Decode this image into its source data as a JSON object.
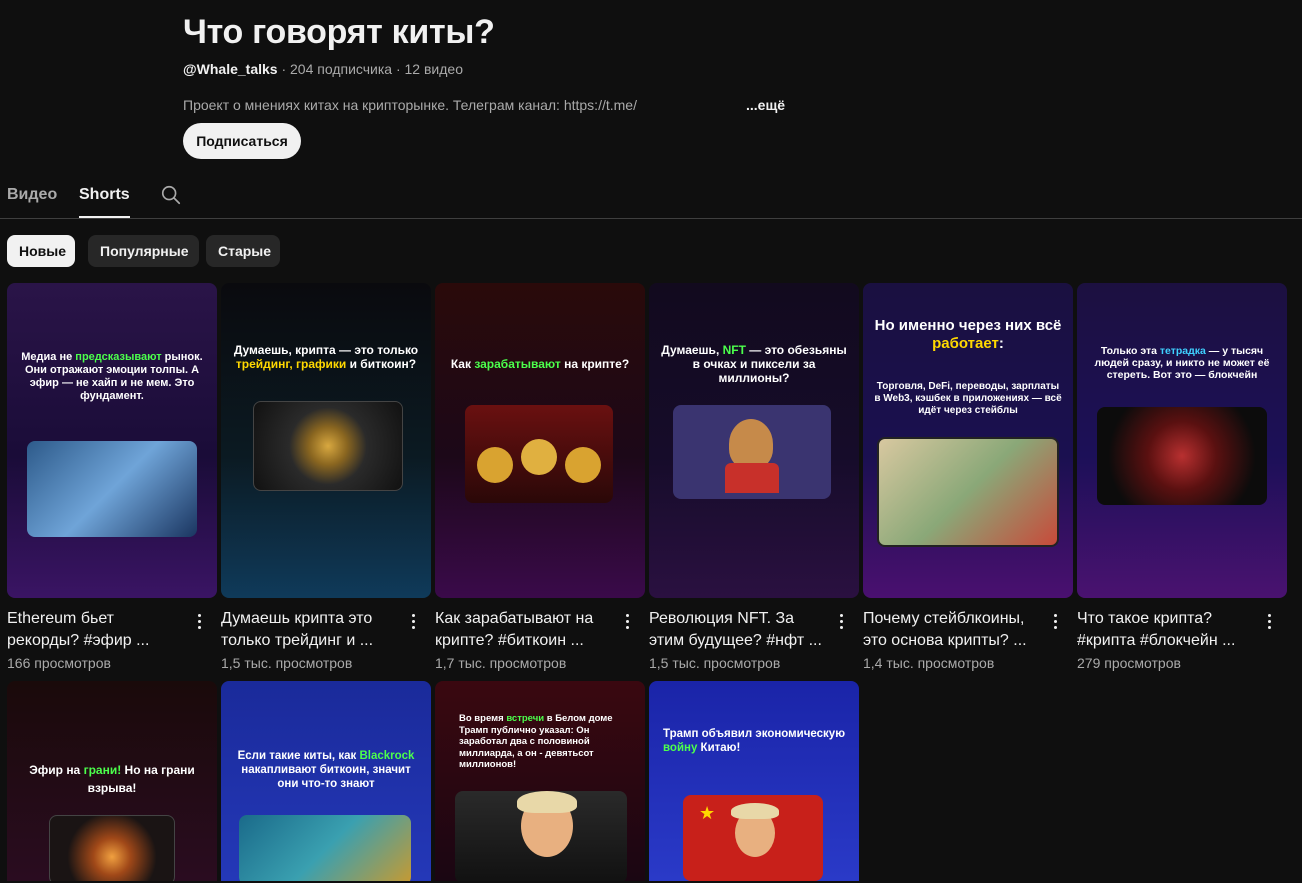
{
  "channel": {
    "title": "Что говорят киты?",
    "handle": "@Whale_talks",
    "subscribers": "· 204 подписчика",
    "videos": "· 12 видео",
    "description": "Проект о мнениях китах на крипторынке. Телеграм канал: https://t.me/",
    "more_label": "...ещё",
    "subscribe_label": "Подписаться"
  },
  "tabs": [
    {
      "label": "Видео",
      "active": false
    },
    {
      "label": "Shorts",
      "active": true
    }
  ],
  "chips": [
    {
      "label": "Новые",
      "selected": true
    },
    {
      "label": "Популярные",
      "selected": false
    },
    {
      "label": "Старые",
      "selected": false
    }
  ],
  "shorts": [
    {
      "title": "Ethereum бьет рекорды? #эфир ...",
      "views": "166 просмотров",
      "thumb": {
        "pre": "Медиа не ",
        "hl": "предсказывают",
        "post": " рынок. Они отражают эмоции толпы. А эфир — не хайп и не мем. Это фундамент."
      }
    },
    {
      "title": "Думаешь крипта это только трейдинг и ...",
      "views": "1,5 тыс. просмотров",
      "thumb": {
        "pre": "Думаешь, крипта — это только ",
        "hl": "трейдинг, графики",
        "post": " и биткоин?"
      }
    },
    {
      "title": "Как зарабатывают на крипте? #биткоин ...",
      "views": "1,7 тыс. просмотров",
      "thumb": {
        "pre": "Как ",
        "hl": "зарабатывают",
        "post": " на крипте?"
      }
    },
    {
      "title": "Революция NFT. За этим будущее? #нфт ...",
      "views": "1,5 тыс. просмотров",
      "thumb": {
        "pre": "Думаешь, ",
        "hl": "NFT",
        "post": " — это обезьяны в очках и пиксели за миллионы?"
      }
    },
    {
      "title": "Почему стейблкоины, это основа крипты? ...",
      "views": "1,4 тыс. просмотров",
      "thumb": {
        "pre": "Но именно через них всё ",
        "hl": "работает",
        "post": ":"
      }
    },
    {
      "title": "Что такое крипта? #крипта #блокчейн ...",
      "views": "279 просмотров",
      "thumb": {
        "pre": "Только эта ",
        "hl": "тетрадка",
        "post": " — у тысяч людей сразу, и никто не может её стереть. Вот это — блокчейн"
      }
    },
    {
      "title": "",
      "views": "",
      "thumb": {
        "pre": "Эфир на ",
        "hl": "грани!",
        "post": " Но на грани взрыва!"
      }
    },
    {
      "title": "",
      "views": "",
      "thumb": {
        "pre": "Если такие киты, как ",
        "hl": "Blackrock",
        "post": " накапливают биткоин, значит они что-то знают"
      }
    },
    {
      "title": "",
      "views": "",
      "thumb": {
        "pre": "Во время ",
        "hl": "встречи",
        "post": " в Белом доме Трамп публично указал: Он заработал два с половиной миллиарда, а он - девятьсот миллионов!"
      }
    },
    {
      "title": "",
      "views": "",
      "thumb": {
        "pre": "Трамп объявил экономическую ",
        "hl": "войну",
        "post": " Китаю!"
      }
    }
  ],
  "thumb_extra": {
    "t5_sub": "Торговля, DeFi, переводы, зарплаты в Web3, кэшбек в приложениях — всё идёт через стейблы"
  },
  "colors": {
    "background": "#0f0f0f",
    "text": "#f1f1f1",
    "muted": "#aaaaaa",
    "chip": "#272727",
    "highlight_green": "#4cff4c",
    "highlight_yellow": "#ffd800"
  }
}
